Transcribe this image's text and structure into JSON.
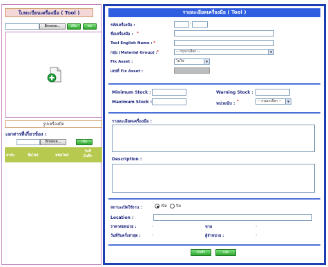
{
  "left": {
    "title": "ใบทะเบียนเครื่องมือ ( Tool )",
    "browse_label": "Browse...",
    "add_label": "เพิ่ม",
    "delete_label": "ลบ",
    "image_caption": "รูปเครื่องมือ",
    "docs_title": "เอกสารที่เกี่ยวข้อง :",
    "docs_browse_label": "Browse...",
    "docs_add_label": "เพิ่ม",
    "table_headers": [
      "ลำดับ",
      "ชื่อไฟล์",
      "ชนิดไฟล์",
      "วันที่ บันทึก"
    ]
  },
  "right": {
    "title": "รายละเอียดเครื่องมือ ( Tool )",
    "tool_code_label": "รหัสเครื่องมือ :",
    "tool_name_label": "ชื่อเครื่องมือ :",
    "tool_english_label": "Tool English Name :",
    "group_label": "กลุ่ม (Material Group) :",
    "group_select": "-- กรุณาเลือก --",
    "fix_asset_label": "Fix Asset :",
    "fix_asset_select": "ไม่ใช่",
    "fix_asset_no_label": "เลขที่ Fix Asset :",
    "min_stock_label": "Minimum Stock :",
    "max_stock_label": "Maximum Stock :",
    "warning_stock_label": "Warning Stock :",
    "unit_label": "หน่วยนับ :",
    "unit_select": "-- กรุณาเลือก --",
    "detail_label": "รายละเอียดเครื่องมือ :",
    "description_label": "Description :",
    "status_label": "สถานะเปิดใช้งาน :",
    "status_open": "เปิด",
    "status_close": "ปิด",
    "location_label": "Location :",
    "unit_price_label": "ราคาต่อหน่วย :",
    "unit_price_value": "-",
    "buy_label": "ขาย",
    "buy_value": "-",
    "receive_date_label": "วันที่รับครั้งล่าสุด :",
    "receive_date_value": "-",
    "supplier_label": "ผู้จำหน่าย :",
    "supplier_value": "-",
    "save_label": "บันทึก",
    "back_label": "กลับ"
  },
  "colors": {
    "frame_blue": "#1b3fb0",
    "title_bg": "#2f5fe0",
    "left_border": "#c080c0",
    "left_title_bg": "#f4d7d7",
    "green": "#3cb43c",
    "olive": "#b7c94f"
  }
}
